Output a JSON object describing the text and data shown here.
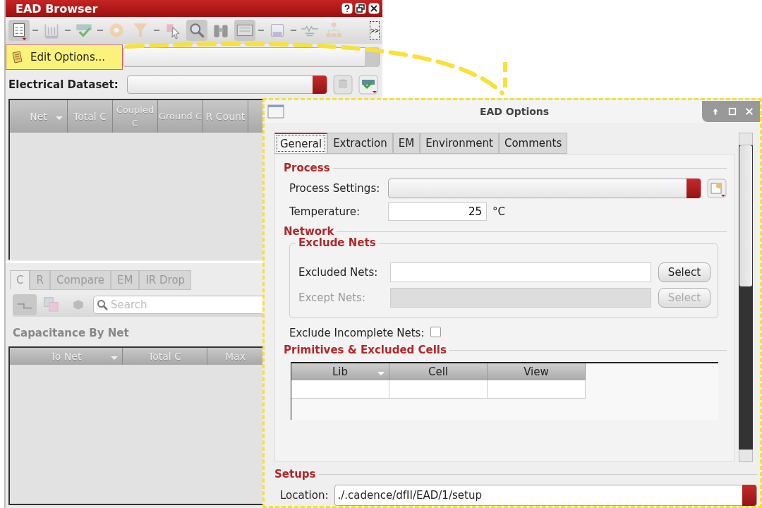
{
  "browser": {
    "title": "EAD Browser",
    "toolbar_overflow": ">>",
    "menu_item": "Edit Options...",
    "dataset_label": "Electrical Dataset:",
    "net_table": {
      "columns": [
        {
          "label": "Net",
          "sort": true
        },
        {
          "label": "Total C",
          "sort": false
        },
        {
          "label": "Coupled C",
          "sort": false
        },
        {
          "label": "Ground C",
          "sort": false
        },
        {
          "label": "R Count",
          "sort": false
        }
      ]
    },
    "tabs": [
      {
        "label": "C",
        "selected": true
      },
      {
        "label": "R",
        "selected": false
      },
      {
        "label": "Compare",
        "selected": false
      },
      {
        "label": "EM",
        "selected": false
      },
      {
        "label": "IR Drop",
        "selected": false
      }
    ],
    "search": {
      "placeholder": "Search"
    },
    "section_title": "Capacitance By Net",
    "cap_table": {
      "columns": [
        {
          "label": "To Net",
          "sort": true
        },
        {
          "label": "Total C",
          "sort": false
        },
        {
          "label": "Max",
          "sort": false
        }
      ]
    }
  },
  "dialog": {
    "title": "EAD Options",
    "tabs": [
      {
        "label": "General",
        "selected": true
      },
      {
        "label": "Extraction",
        "selected": false
      },
      {
        "label": "EM",
        "selected": false
      },
      {
        "label": "Environment",
        "selected": false
      },
      {
        "label": "Comments",
        "selected": false
      }
    ],
    "process": {
      "heading": "Process",
      "settings_label": "Process Settings:",
      "temperature_label": "Temperature:",
      "temperature": "25",
      "unit": "°C"
    },
    "network": {
      "heading": "Network",
      "group": "Exclude Nets",
      "fields": [
        {
          "label": "Excluded Nets:",
          "button": "Select",
          "disabled": false
        },
        {
          "label": "Except Nets:",
          "button": "Select",
          "disabled": true
        }
      ],
      "incomplete": {
        "label": "Exclude Incomplete Nets:",
        "checked": false
      }
    },
    "primitives": {
      "heading": "Primitives & Excluded Cells",
      "columns": [
        {
          "label": "Lib",
          "sort": true
        },
        {
          "label": "Cell",
          "sort": false
        },
        {
          "label": "View",
          "sort": false
        }
      ]
    },
    "setups": {
      "heading": "Setups",
      "location_label": "Location:",
      "location": "./.cadence/dfII/EAD/1/setup"
    }
  }
}
